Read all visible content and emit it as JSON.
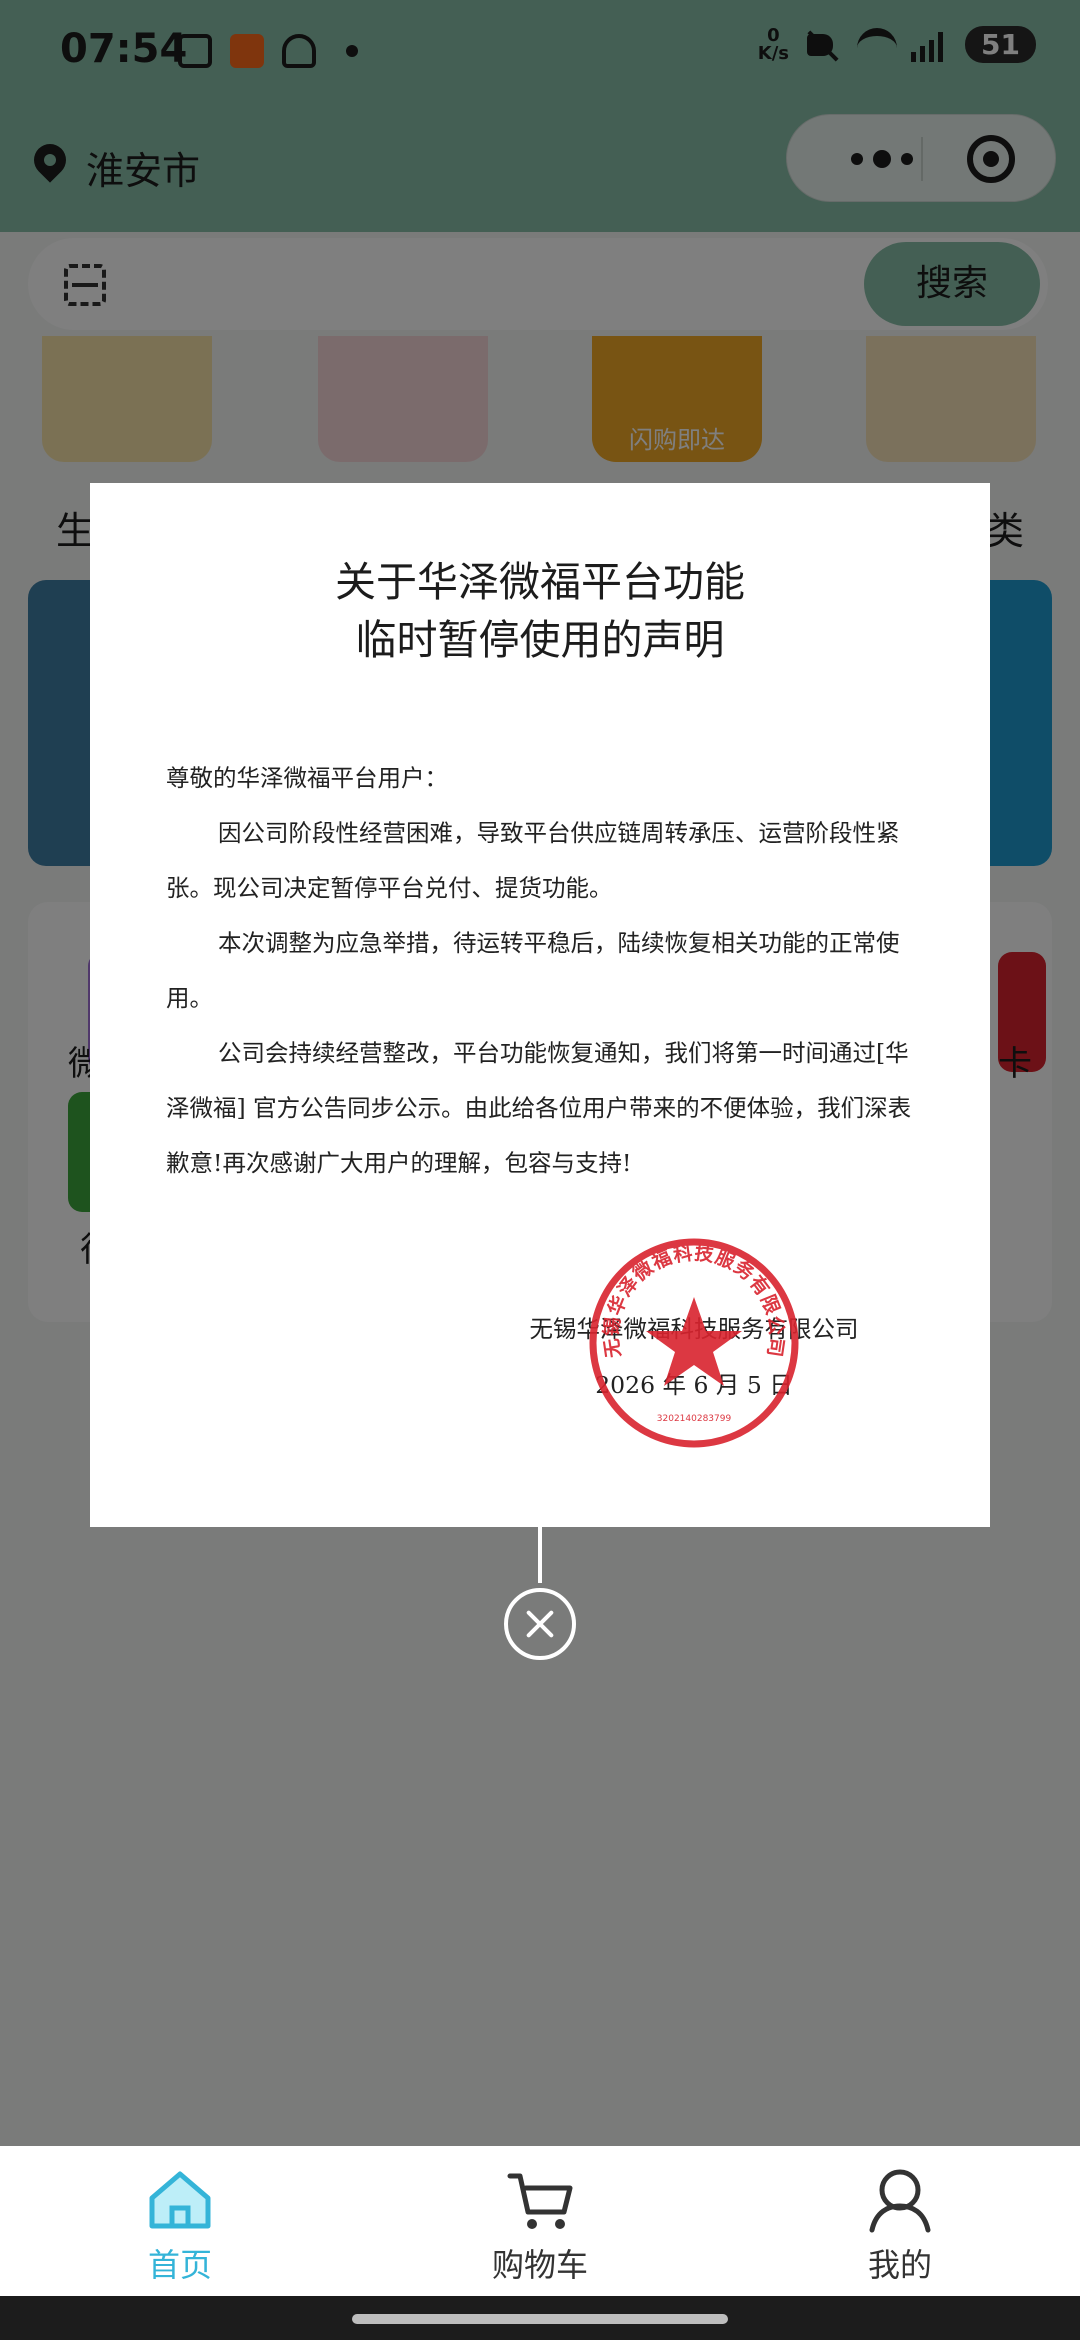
{
  "status_bar": {
    "time": "07:54",
    "net_speed_value": "0",
    "net_speed_unit": "K/s",
    "battery": "51",
    "icons": [
      "screenshot-icon",
      "app-notification-icon",
      "cloud-icon",
      "dot-icon",
      "mute-icon",
      "wifi-icon",
      "signal-icon",
      "battery-icon"
    ]
  },
  "header": {
    "location": "淮安市",
    "location_icon": "location-pin-icon",
    "capsule_icons": [
      "more-icon",
      "close-miniapp-icon"
    ]
  },
  "search": {
    "scan_icon": "scan-icon",
    "button_label": "搜索"
  },
  "background_page": {
    "categories": [
      {
        "icon": "cake-icon",
        "label": "生"
      },
      {
        "icon": "popcorn-icon",
        "label": ""
      },
      {
        "icon": "delivery-icon",
        "label": "",
        "badge": "闪购即达"
      },
      {
        "icon": "grid-icon",
        "label": "类"
      }
    ],
    "grid_labels": [
      "微",
      "",
      "卡",
      "很"
    ]
  },
  "notice": {
    "title_line1": "关于华泽微福平台功能",
    "title_line2": "临时暂停使用的声明",
    "greeting": "尊敬的华泽微福平台用户：",
    "paragraph1": "因公司阶段性经营困难，导致平台供应链周转承压、运营阶段性紧张。现公司决定暂停平台兑付、提货功能。",
    "paragraph2": "本次调整为应急举措，待运转平稳后，陆续恢复相关功能的正常使用。",
    "paragraph3": "公司会持续经营整改，平台功能恢复通知，我们将第一时间通过[华泽微福] 官方公告同步公示。由此给各位用户带来的不便体验，我们深表歉意!再次感谢广大用户的理解，包容与支持!",
    "signature_company": "无锡华泽微福科技服务有限公司",
    "signature_date": "2026 年 6 月 5 日",
    "seal_text": "无锡华泽微福科技服务有限公司",
    "seal_number": "3202140283799",
    "seal_color": "#d9232e"
  },
  "tabbar": {
    "items": [
      {
        "label": "首页",
        "icon": "home-icon",
        "active": true
      },
      {
        "label": "购物车",
        "icon": "cart-icon",
        "active": false
      },
      {
        "label": "我的",
        "icon": "profile-icon",
        "active": false
      }
    ],
    "active_color": "#34b4d8"
  },
  "colors": {
    "header_green": "#88bfa8",
    "overlay": "rgba(0,0,0,0.5)"
  }
}
